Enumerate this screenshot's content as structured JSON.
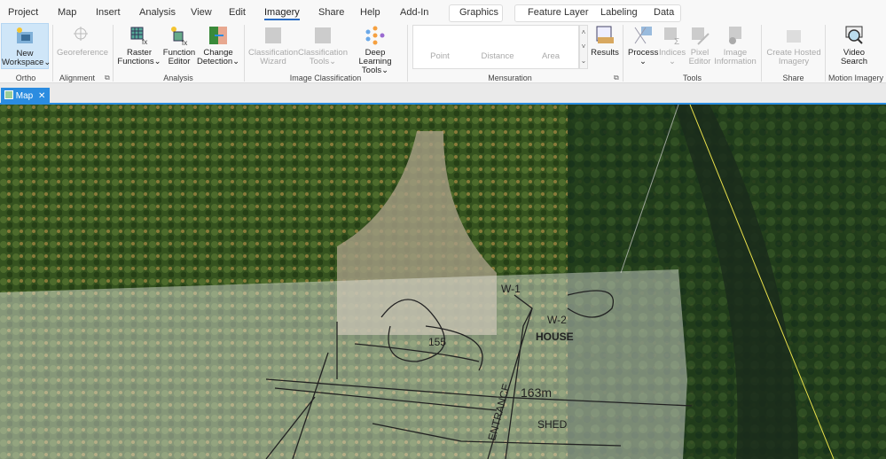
{
  "tabs": [
    "Project",
    "Map",
    "Insert",
    "Analysis",
    "View",
    "Edit",
    "Imagery",
    "Share",
    "Help",
    "Add-In"
  ],
  "active_tab": "Imagery",
  "context_tabs": {
    "graphics": "Graphics",
    "feature_layer": "Feature Layer",
    "labeling": "Labeling",
    "data": "Data"
  },
  "ribbon": {
    "new_workspace": [
      "New",
      "Workspace"
    ],
    "georeference": "Georeference",
    "raster_functions": [
      "Raster",
      "Functions"
    ],
    "function_editor": [
      "Function",
      "Editor"
    ],
    "change_detection": [
      "Change",
      "Detection"
    ],
    "classification_wizard": [
      "Classification",
      "Wizard"
    ],
    "classification_tools": [
      "Classification",
      "Tools"
    ],
    "deep_learning_tools": [
      "Deep Learning",
      "Tools"
    ],
    "point": "Point",
    "distance": "Distance",
    "area": "Area",
    "results": "Results",
    "process": "Process",
    "indices": "Indices",
    "pixel_editor": [
      "Pixel",
      "Editor"
    ],
    "image_information": [
      "Image",
      "Information"
    ],
    "create_hosted_imagery": [
      "Create Hosted",
      "Imagery"
    ],
    "video_search": [
      "Video",
      "Search"
    ],
    "groups": {
      "ortho": "Ortho Mapping",
      "alignment": "Alignment",
      "analysis": "Analysis",
      "image_classification": "Image Classification",
      "mensuration": "Mensuration",
      "tools": "Tools",
      "share": "Share",
      "motion_imagery": "Motion Imagery"
    }
  },
  "view_tab": {
    "label": "Map",
    "close": "✕"
  },
  "map_labels": {
    "elev": "155",
    "w1": "W-1",
    "w2": "W-2",
    "house": "HOUSE",
    "entrance": "ENTRANCE",
    "dist": "163m",
    "shed": "SHED"
  }
}
